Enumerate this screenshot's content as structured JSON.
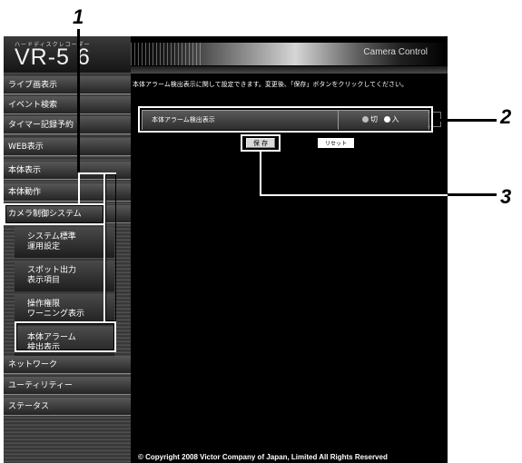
{
  "header": {
    "logo_subtitle": "ハードディスクレコーダー",
    "logo_main": "VR-5 6",
    "app_title": "Camera Control"
  },
  "sidebar": {
    "items": [
      {
        "label": "ライブ画表示"
      },
      {
        "label": "イベント検索"
      },
      {
        "label": "タイマー記録予約"
      },
      {
        "label": "WEB表示"
      },
      {
        "label": "本体表示"
      },
      {
        "label": "本体動作"
      },
      {
        "label": "カメラ制御システム"
      }
    ],
    "sub_items": [
      {
        "line1": "システム標準",
        "line2": "運用設定"
      },
      {
        "line1": "スポット出力",
        "line2": "表示項目"
      },
      {
        "line1": "操作権限",
        "line2": "ワーニング表示"
      },
      {
        "line1": "本体アラーム",
        "line2": "検出表示"
      }
    ],
    "bottom_items": [
      {
        "label": "ネットワーク"
      },
      {
        "label": "ユーティリティー"
      },
      {
        "label": "ステータス"
      }
    ]
  },
  "main": {
    "instruction": "本体アラーム検出表示に関して設定できます。変更後、「保存」ボタンをクリックしてください。",
    "setting": {
      "label": "本体アラーム検出表示",
      "option_off": "切",
      "option_on": "入",
      "selected": "入"
    },
    "buttons": {
      "save": "保 存",
      "reset": "リセット"
    }
  },
  "footer": {
    "copyright": "© Copyright 2008 Victor Company of Japan, Limited All Rights Reserved"
  },
  "callouts": {
    "one": "1",
    "two": "2",
    "three": "3"
  }
}
